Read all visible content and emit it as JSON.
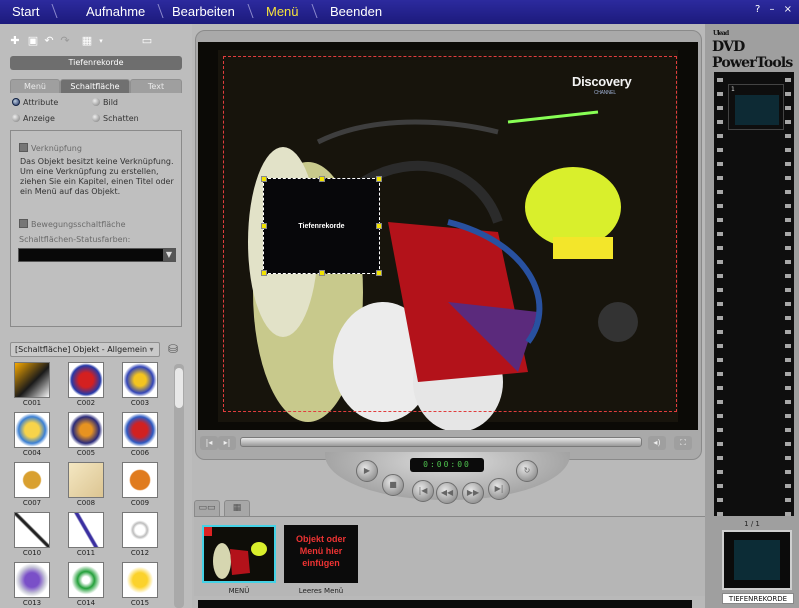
{
  "nav": {
    "items": [
      {
        "label": "Start",
        "active": false
      },
      {
        "label": "Aufnahme",
        "active": false
      },
      {
        "label": "Bearbeiten",
        "active": false
      },
      {
        "label": "Menü",
        "active": true
      },
      {
        "label": "Beenden",
        "active": false
      }
    ],
    "window_controls": "? – ×",
    "active_color": "#f6e33c"
  },
  "left": {
    "object_name": "Tiefenrekorde",
    "tabs": [
      "Menü",
      "Schaltfläche",
      "Text"
    ],
    "radios": [
      "Attribute",
      "Bild",
      "Anzeige",
      "Schatten"
    ],
    "selected_radio": "Attribute",
    "link_checkbox": "Verknüpfung",
    "link_description": "Das Objekt besitzt keine Verknüpfung. Um eine Verknüpfung zu erstellen, ziehen Sie ein Kapitel, einen Titel oder ein Menü auf das Objekt.",
    "motion_checkbox": "Bewegungsschaltfläche",
    "status_colors_label": "Schaltflächen-Statusfarben:",
    "library_dropdown": "[Schaltfläche] Objekt - Allgemein",
    "library_items": [
      "C001",
      "C002",
      "C003",
      "C004",
      "C005",
      "C006",
      "C007",
      "C008",
      "C009",
      "C010",
      "C011",
      "C012",
      "C013",
      "C014",
      "C015"
    ]
  },
  "preview": {
    "logo": "Discovery",
    "logo_sub": "CHANNEL",
    "button_caption": "Tiefenrekorde",
    "timecode": "0:00:00"
  },
  "strip": {
    "menus": [
      {
        "label": "MENÜ"
      },
      {
        "label": "Leeres Menü",
        "placeholder": "Objekt oder Menü hier einfügen"
      }
    ]
  },
  "right": {
    "brand_prefix": "Ulead",
    "brand": "DVD PowerTools",
    "film_cell_number": "1",
    "page_count": "1 / 1",
    "chapter_label": "TIEFENREKORDE"
  }
}
